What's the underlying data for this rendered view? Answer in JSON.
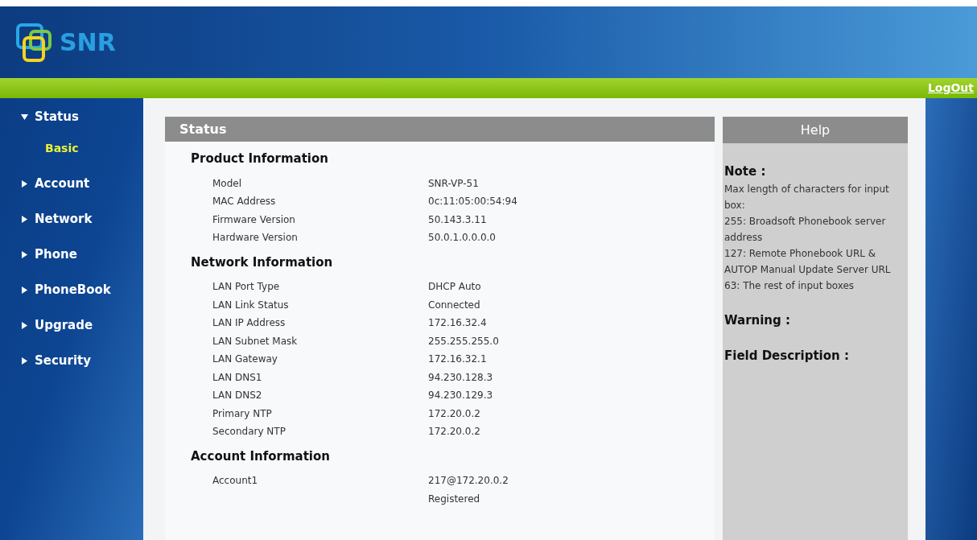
{
  "header": {
    "logo_text": "SNR",
    "logout": "LogOut"
  },
  "sidebar": {
    "items": [
      {
        "label": "Status",
        "expanded": true,
        "children": [
          {
            "label": "Basic",
            "selected": true
          }
        ]
      },
      {
        "label": "Account",
        "expanded": false
      },
      {
        "label": "Network",
        "expanded": false
      },
      {
        "label": "Phone",
        "expanded": false
      },
      {
        "label": "PhoneBook",
        "expanded": false
      },
      {
        "label": "Upgrade",
        "expanded": false
      },
      {
        "label": "Security",
        "expanded": false
      }
    ]
  },
  "status_panel": {
    "title": "Status",
    "sections": [
      {
        "title": "Product Information",
        "rows": [
          {
            "label": "Model",
            "values": [
              "SNR-VP-51"
            ]
          },
          {
            "label": "MAC Address",
            "values": [
              "0c:11:05:00:54:94"
            ]
          },
          {
            "label": "Firmware Version",
            "values": [
              "50.143.3.11"
            ]
          },
          {
            "label": "Hardware Version",
            "values": [
              "50.0.1.0.0.0.0"
            ]
          }
        ]
      },
      {
        "title": "Network Information",
        "rows": [
          {
            "label": "LAN Port Type",
            "values": [
              "DHCP Auto"
            ]
          },
          {
            "label": "LAN Link Status",
            "values": [
              "Connected"
            ]
          },
          {
            "label": "LAN IP Address",
            "values": [
              "172.16.32.4"
            ]
          },
          {
            "label": "LAN Subnet Mask",
            "values": [
              "255.255.255.0"
            ]
          },
          {
            "label": "LAN Gateway",
            "values": [
              "172.16.32.1"
            ]
          },
          {
            "label": "LAN DNS1",
            "values": [
              "94.230.128.3"
            ]
          },
          {
            "label": "LAN DNS2",
            "values": [
              "94.230.129.3"
            ]
          },
          {
            "label": "Primary NTP",
            "values": [
              "172.20.0.2"
            ]
          },
          {
            "label": "Secondary NTP",
            "values": [
              "172.20.0.2"
            ]
          }
        ]
      },
      {
        "title": "Account Information",
        "rows": [
          {
            "label": "Account1",
            "values": [
              "217@172.20.0.2",
              "Registered"
            ]
          }
        ]
      }
    ]
  },
  "help_panel": {
    "title": "Help",
    "note_heading": "Note :",
    "note_lines": [
      "Max length of characters for input box:",
      "255: Broadsoft Phonebook server address",
      "127: Remote Phonebook URL & AUTOP Manual Update Server URL",
      "63: The rest of input boxes"
    ],
    "warning_heading": "Warning :",
    "field_heading": "Field Description :"
  }
}
